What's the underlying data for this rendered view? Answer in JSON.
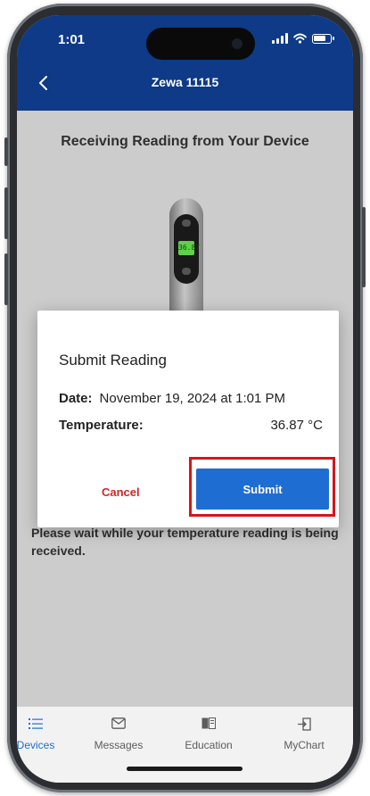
{
  "status_bar": {
    "time": "1:01"
  },
  "header": {
    "title": "Zewa 11115",
    "back_icon": "chevron-left-icon"
  },
  "content": {
    "heading": "Receiving Reading from Your Device",
    "device_display": "36.87",
    "wait_text": "Please wait while your temperature reading is being received."
  },
  "dialog": {
    "title": "Submit Reading",
    "date_label": "Date:",
    "date_value": "November 19, 2024 at 1:01 PM",
    "temperature_label": "Temperature:",
    "temperature_value": "36.87 °C",
    "cancel_label": "Cancel",
    "submit_label": "Submit"
  },
  "tabs": [
    {
      "label": "Devices",
      "icon": "list-icon",
      "active": true
    },
    {
      "label": "Messages",
      "icon": "envelope-icon",
      "active": false
    },
    {
      "label": "Education",
      "icon": "book-icon",
      "active": false
    },
    {
      "label": "MyChart",
      "icon": "exit-icon",
      "active": false
    }
  ],
  "colors": {
    "header_bg": "#0e3a87",
    "primary_button": "#1e6dd2",
    "cancel_text": "#d72424",
    "highlight_border": "#d8141b"
  }
}
